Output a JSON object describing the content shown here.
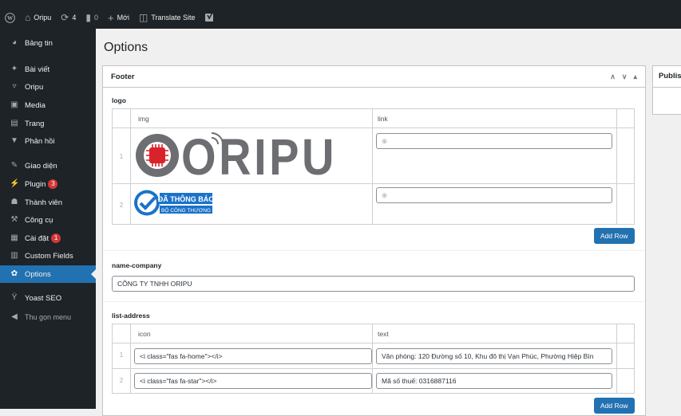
{
  "admin_bar": {
    "site_name": "Oripu",
    "updates_count": "4",
    "comments_count": "0",
    "new_label": "Mới",
    "translate_label": "Translate Site",
    "icons": [
      "wordpress-logo-icon",
      "home-icon",
      "updates-icon",
      "comments-icon",
      "plus-icon",
      "translate-icon",
      "yoast-icon"
    ]
  },
  "sidebar": {
    "items": [
      {
        "label": "Bảng tin",
        "icon": "dashboard-icon"
      },
      {
        "label": "Bài viết",
        "icon": "pin-icon"
      },
      {
        "label": "Oripu",
        "icon": "cart-icon"
      },
      {
        "label": "Media",
        "icon": "media-icon"
      },
      {
        "label": "Trang",
        "icon": "page-icon"
      },
      {
        "label": "Phản hồi",
        "icon": "comment-icon"
      },
      {
        "label": "Giao diện",
        "icon": "brush-icon"
      },
      {
        "label": "Plugin",
        "icon": "plugin-icon",
        "badge": "3"
      },
      {
        "label": "Thành viên",
        "icon": "users-icon"
      },
      {
        "label": "Công cụ",
        "icon": "wrench-icon"
      },
      {
        "label": "Cài đặt",
        "icon": "settings-icon",
        "badge": "1"
      },
      {
        "label": "Custom Fields",
        "icon": "fields-icon"
      },
      {
        "label": "Options",
        "icon": "gear-icon",
        "active": true
      },
      {
        "label": "Yoast SEO",
        "icon": "yoast-icon"
      },
      {
        "label": "Thu gọn menu",
        "icon": "collapse-icon"
      }
    ],
    "active_color": "#2271b1",
    "badge_color": "#d63638"
  },
  "page": {
    "title": "Options"
  },
  "panel": {
    "title": "Footer",
    "fields": {
      "logo": {
        "label": "logo",
        "columns": [
          "img",
          "link"
        ],
        "rows": [
          {
            "order": "1",
            "image_text": "ORIPU",
            "link": ""
          },
          {
            "order": "2",
            "image_text_line1": "ĐÃ THÔNG BÁO",
            "image_text_line2": "BỘ CÔNG THƯƠNG",
            "link": ""
          }
        ],
        "add_row_label": "Add Row"
      },
      "name_company": {
        "label": "name-company",
        "value": "CÔNG TY TNHH ORIPU"
      },
      "list_address": {
        "label": "list-address",
        "columns": [
          "icon",
          "text"
        ],
        "rows": [
          {
            "order": "1",
            "icon": "<i class=\"fas fa-home\"></i>",
            "text": "Văn phòng: 120 Đường số 10, Khu đô thị Vạn Phúc, Phường Hiệp Bìn"
          },
          {
            "order": "2",
            "icon": "<i class=\"fas fa-star\"></i>",
            "text": "Mã số thuế: 0316887116"
          }
        ],
        "add_row_label": "Add Row"
      }
    }
  },
  "publish_box": {
    "title": "Publish"
  },
  "colors": {
    "admin_dark": "#1d2327",
    "primary": "#2271b1",
    "oripu_red": "#d8232a",
    "oripu_gray": "#6d6e71",
    "bct_blue": "#1a73c9"
  }
}
